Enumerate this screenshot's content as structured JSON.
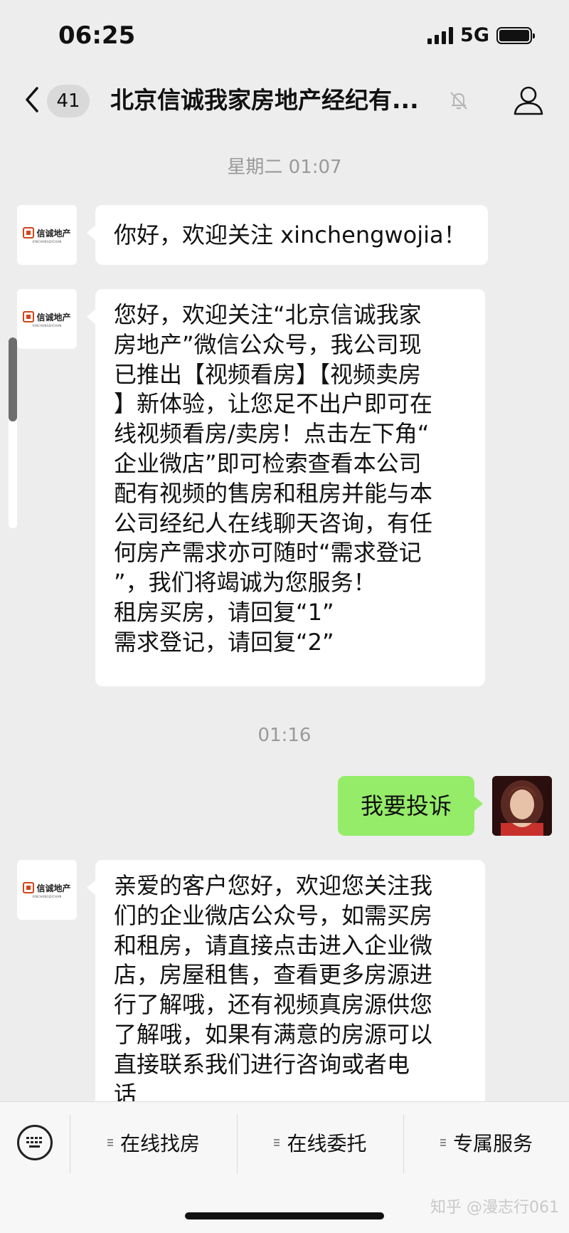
{
  "status_bar": {
    "time": "06:25",
    "network": "5G"
  },
  "header": {
    "unread_count": "41",
    "title": "北京信诚我家房地产经纪有..."
  },
  "chat": {
    "timestamp_1": "星期二 01:07",
    "company_logo_text": "信诚地产",
    "company_logo_sub": "XINCHENGDICHAN",
    "msg_1": "你好，欢迎关注 xinchengwojia！",
    "msg_2": "您好，欢迎关注“北京信诚我家\n房地产”微信公众号，我公司现\n已推出【视频看房】【视频卖房\n】新体验，让您足不出户即可在\n线视频看房/卖房！点击左下角“\n企业微店”即可检索查看本公司\n配有视频的售房和租房并能与本\n公司经纪人在线聊天咨询，有任\n何房产需求亦可随时“需求登记\n”，我们将竭诚为您服务！\n租房买房，请回复“1”\n需求登记，请回复“2”",
    "timestamp_2": "01:16",
    "msg_user": "我要投诉",
    "msg_3": "亲爱的客户您好，欢迎您关注我\n们的企业微店公众号，如需买房\n和租房，请直接点击进入企业微\n店，房屋租售，查看更多房源进\n行了解哦，还有视频真房源供您\n了解哦，如果有满意的房源可以\n直接联系我们进行咨询或者电\n话"
  },
  "bottom_menu": {
    "items": [
      {
        "label": "在线找房"
      },
      {
        "label": "在线委托"
      },
      {
        "label": "专属服务"
      }
    ],
    "watermark": "知乎 @漫志行061"
  }
}
